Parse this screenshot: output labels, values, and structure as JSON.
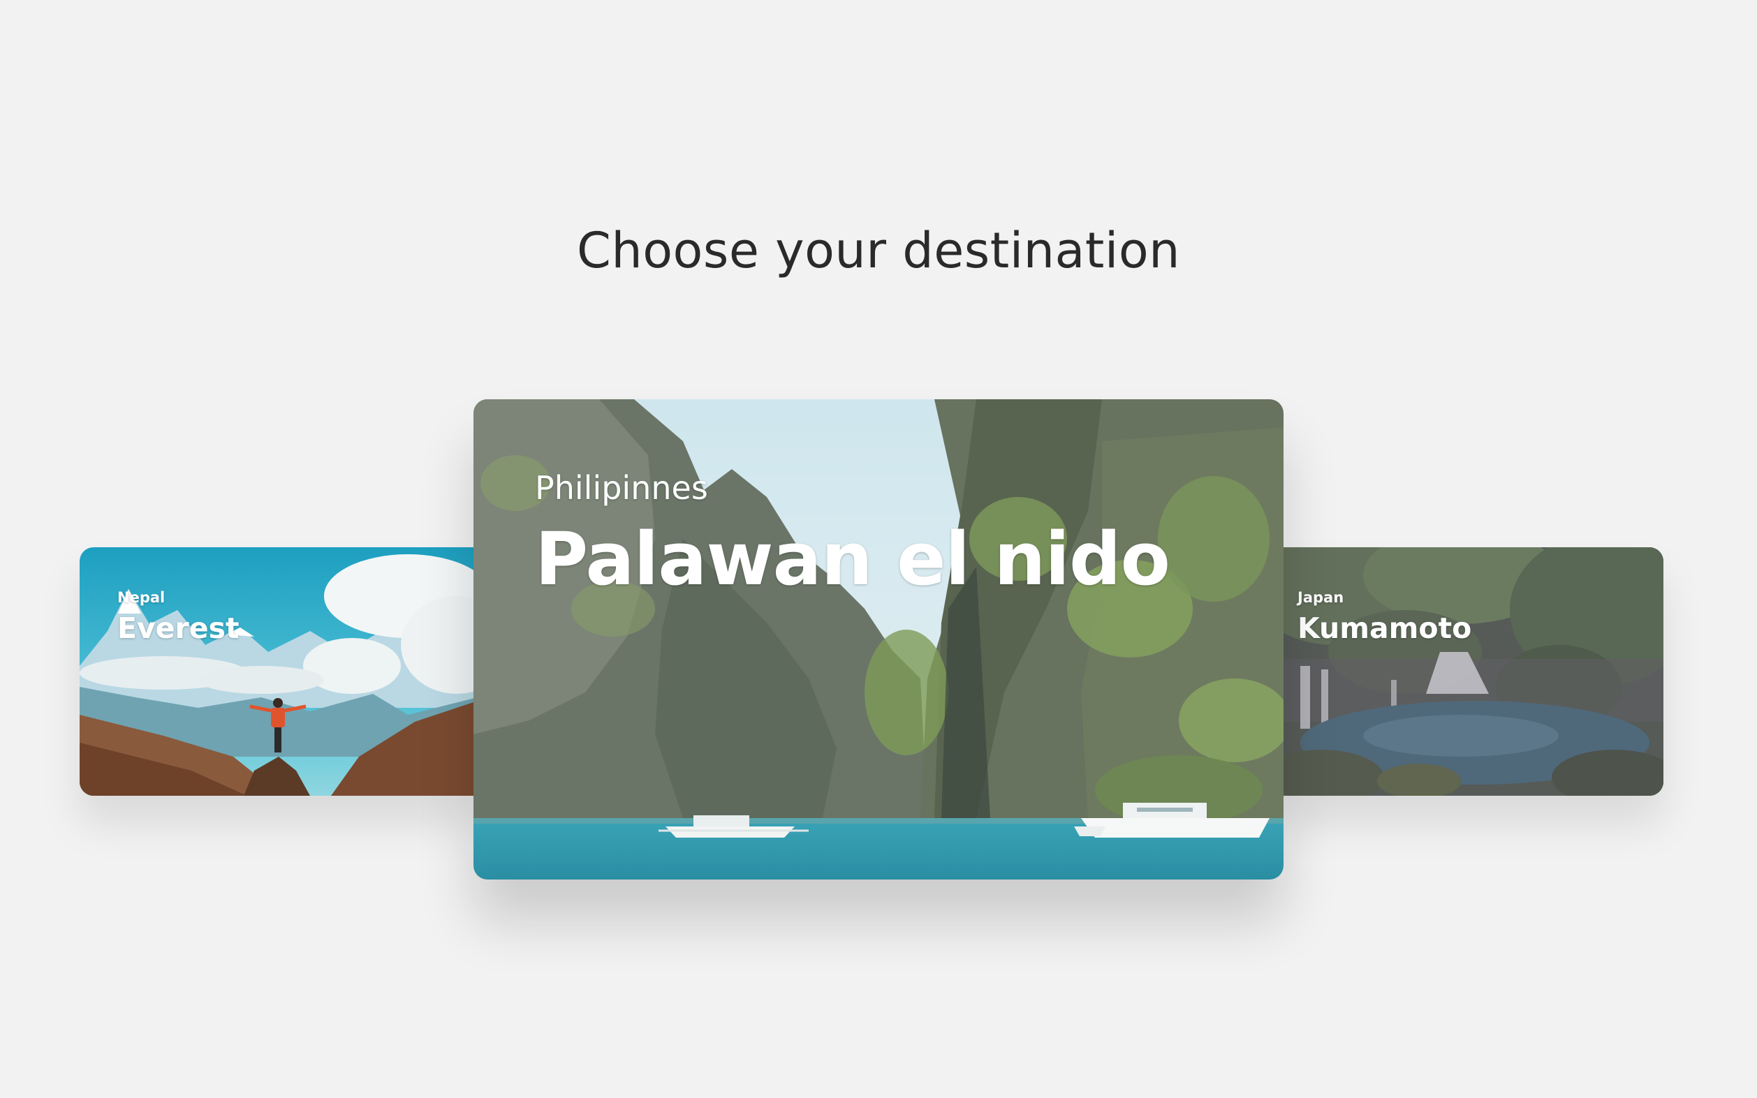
{
  "heading": "Choose your destination",
  "destinations": [
    {
      "country": "Nepal",
      "place": "Everest"
    },
    {
      "country": "Philipinnes",
      "place": "Palawan el nido"
    },
    {
      "country": "Japan",
      "place": "Kumamoto"
    }
  ],
  "colors": {
    "background": "#f2f2f2",
    "heading": "#2a2a2a",
    "card_text": "#ffffff"
  }
}
